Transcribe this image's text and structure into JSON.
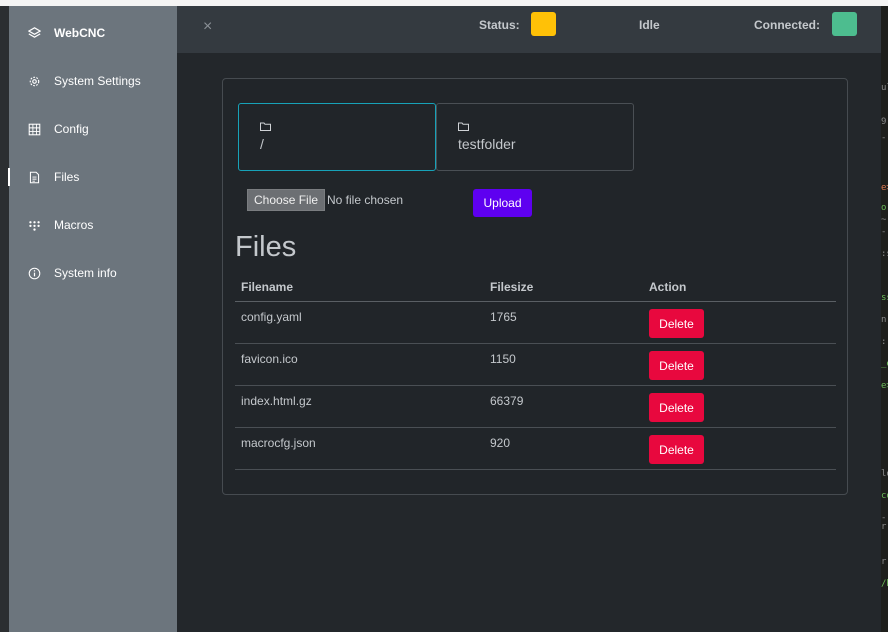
{
  "sidebar": {
    "items": [
      {
        "label": "WebCNC",
        "icon": "layers-icon"
      },
      {
        "label": "System Settings",
        "icon": "gear-icon"
      },
      {
        "label": "Config",
        "icon": "grid-icon"
      },
      {
        "label": "Files",
        "icon": "file-icon"
      },
      {
        "label": "Macros",
        "icon": "dots-grid-icon"
      },
      {
        "label": "System info",
        "icon": "info-icon"
      }
    ],
    "active": "Files"
  },
  "topbar": {
    "close": "×",
    "status_label": "Status:",
    "status_color": "#ffc107",
    "state": "Idle",
    "connected_label": "Connected:",
    "connected_color": "#4dbd8f"
  },
  "folders": [
    {
      "name": "/",
      "icon": "folder-icon",
      "selected": true
    },
    {
      "name": "testfolder",
      "icon": "folder-icon",
      "selected": false
    }
  ],
  "upload": {
    "choose_label": "Choose File",
    "no_file_text": "No file chosen",
    "upload_label": "Upload"
  },
  "files": {
    "heading": "Files",
    "columns": [
      "Filename",
      "Filesize",
      "Action"
    ],
    "rows": [
      {
        "name": "config.yaml",
        "size": "1765",
        "action": "Delete"
      },
      {
        "name": "favicon.ico",
        "size": "1150",
        "action": "Delete"
      },
      {
        "name": "index.html.gz",
        "size": "66379",
        "action": "Delete"
      },
      {
        "name": "macrocfg.json",
        "size": "920",
        "action": "Delete"
      }
    ]
  },
  "colors": {
    "sidebar_bg": "#6c757d",
    "topbar_bg": "#343a40",
    "upload_btn": "#5e00f0",
    "delete_btn": "#e8083e",
    "selected_border": "#17a2b8"
  }
}
